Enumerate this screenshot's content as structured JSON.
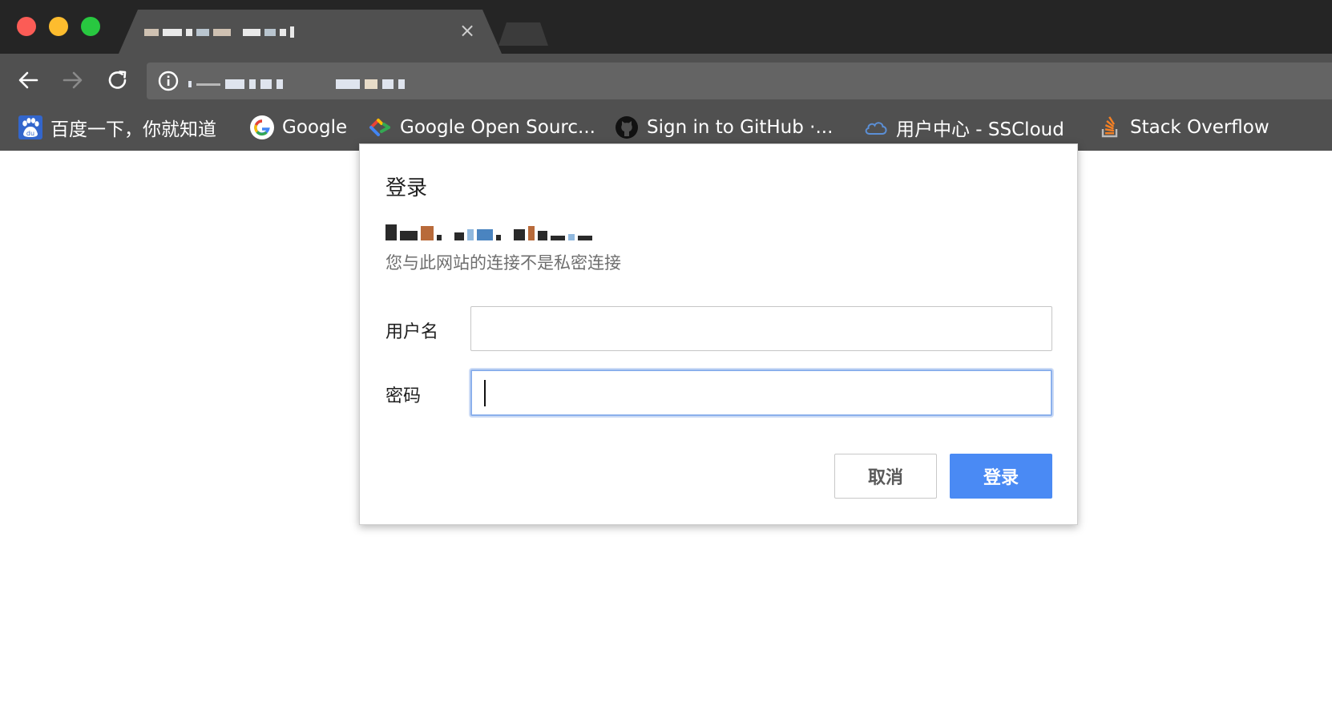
{
  "tabs": [
    {
      "title": "",
      "active": true,
      "close_label": "×"
    }
  ],
  "omnibox": {
    "url": ""
  },
  "bookmarks": [
    {
      "label": "百度一下，你就知道",
      "icon": "baidu-paw-icon"
    },
    {
      "label": "Google",
      "icon": "google-g-icon"
    },
    {
      "label": "Google Open Sourc...",
      "icon": "google-open-source-icon"
    },
    {
      "label": "Sign in to GitHub ·...",
      "icon": "github-octocat-icon"
    },
    {
      "label": "用户中心 - SSCloud",
      "icon": "cloud-icon"
    },
    {
      "label": "Stack Overflow",
      "icon": "stack-overflow-icon"
    }
  ],
  "dialog": {
    "title": "登录",
    "host": "",
    "subtitle": "您与此网站的连接不是私密连接",
    "username_label": "用户名",
    "username_value": "",
    "password_label": "密码",
    "password_value": "",
    "cancel_label": "取消",
    "login_label": "登录"
  },
  "colors": {
    "tabstrip": "#252525",
    "toolbar": "#505050",
    "omnibox": "#646464",
    "primary_button": "#4a8af4",
    "focus_ring": "#8bb0ec"
  }
}
